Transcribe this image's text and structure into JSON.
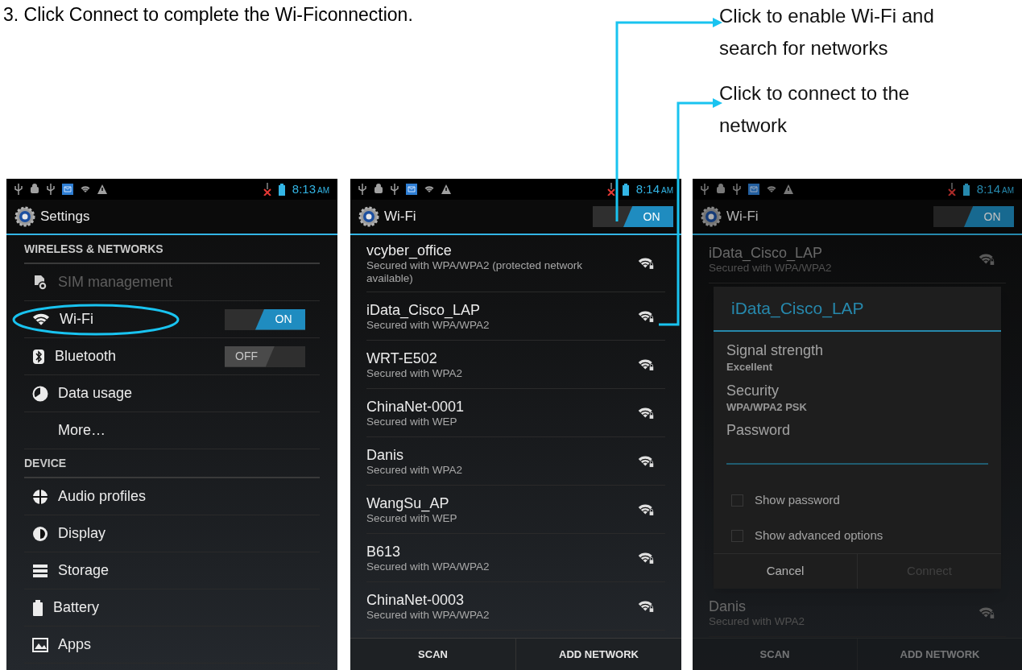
{
  "instruction": "3.  Click Connect to complete the Wi-Ficonnection.",
  "callouts": [
    {
      "text": "Click to enable Wi-Fi and search for networks"
    },
    {
      "text": "Click to connect to the network"
    }
  ],
  "screens": [
    {
      "kind": "settings",
      "dimmed": false,
      "time": "8:13",
      "ampm": "AM",
      "title": "Settings",
      "items": [
        {
          "kind": "header",
          "label": "WIRELESS & NETWORKS"
        },
        {
          "kind": "item",
          "label": "SIM management",
          "disabled": true,
          "circled": false
        },
        {
          "kind": "item",
          "label": "Wi-Fi",
          "disabled": false,
          "circled": true,
          "toggle": {
            "on": true,
            "label": "ON"
          }
        },
        {
          "kind": "item",
          "label": "Bluetooth",
          "disabled": false,
          "circled": false,
          "toggle": {
            "on": false,
            "label": "OFF"
          }
        },
        {
          "kind": "item",
          "label": "Data usage",
          "disabled": false,
          "circled": false
        },
        {
          "kind": "item",
          "label": "More…",
          "disabled": false,
          "circled": false
        },
        {
          "kind": "header",
          "label": "DEVICE"
        },
        {
          "kind": "item",
          "label": "Audio profiles",
          "disabled": false,
          "circled": false
        },
        {
          "kind": "item",
          "label": "Display",
          "disabled": false,
          "circled": false
        },
        {
          "kind": "item",
          "label": "Storage",
          "disabled": false,
          "circled": false
        },
        {
          "kind": "item",
          "label": "Battery",
          "disabled": false,
          "circled": false
        },
        {
          "kind": "item",
          "label": "Apps",
          "disabled": false,
          "circled": false
        }
      ]
    },
    {
      "kind": "wifi_list",
      "dimmed": false,
      "time": "8:14",
      "ampm": "AM",
      "title": "Wi-Fi",
      "toggle": {
        "on": true,
        "label": "ON"
      },
      "networks": [
        {
          "name": "vcyber_office",
          "security": "Secured with WPA/WPA2 (protected network available)"
        },
        {
          "name": "iData_Cisco_LAP",
          "security": "Secured with WPA/WPA2"
        },
        {
          "name": "WRT-E502",
          "security": "Secured with WPA2"
        },
        {
          "name": "ChinaNet-0001",
          "security": "Secured with WEP"
        },
        {
          "name": "Danis",
          "security": "Secured with WPA2"
        },
        {
          "name": "WangSu_AP",
          "security": "Secured with WEP"
        },
        {
          "name": "B613",
          "security": "Secured with WPA/WPA2"
        },
        {
          "name": "ChinaNet-0003",
          "security": "Secured with WPA/WPA2"
        }
      ],
      "bottom_buttons": [
        "SCAN",
        "ADD NETWORK"
      ]
    },
    {
      "kind": "wifi_dialog",
      "dimmed": true,
      "time": "8:14",
      "ampm": "AM",
      "title": "Wi-Fi",
      "toggle": {
        "on": true,
        "label": "ON"
      },
      "networks": [
        {
          "name": "iData_Cisco_LAP",
          "security": "Secured with WPA/WPA2"
        },
        {
          "name": "Danis",
          "security": "Secured with WPA2"
        }
      ],
      "dialog": {
        "title": "iData_Cisco_LAP",
        "fields": [
          {
            "label": "Signal strength",
            "value": "Excellent"
          },
          {
            "label": "Security",
            "value": "WPA/WPA2 PSK"
          }
        ],
        "password_label": "Password",
        "checkboxes": [
          {
            "label": "Show password",
            "checked": false
          },
          {
            "label": "Show advanced options",
            "checked": false
          }
        ],
        "buttons": [
          {
            "label": "Cancel",
            "disabled": false
          },
          {
            "label": "Connect",
            "disabled": true
          }
        ]
      },
      "bottom_buttons": [
        "SCAN",
        "ADD NETWORK"
      ]
    }
  ]
}
